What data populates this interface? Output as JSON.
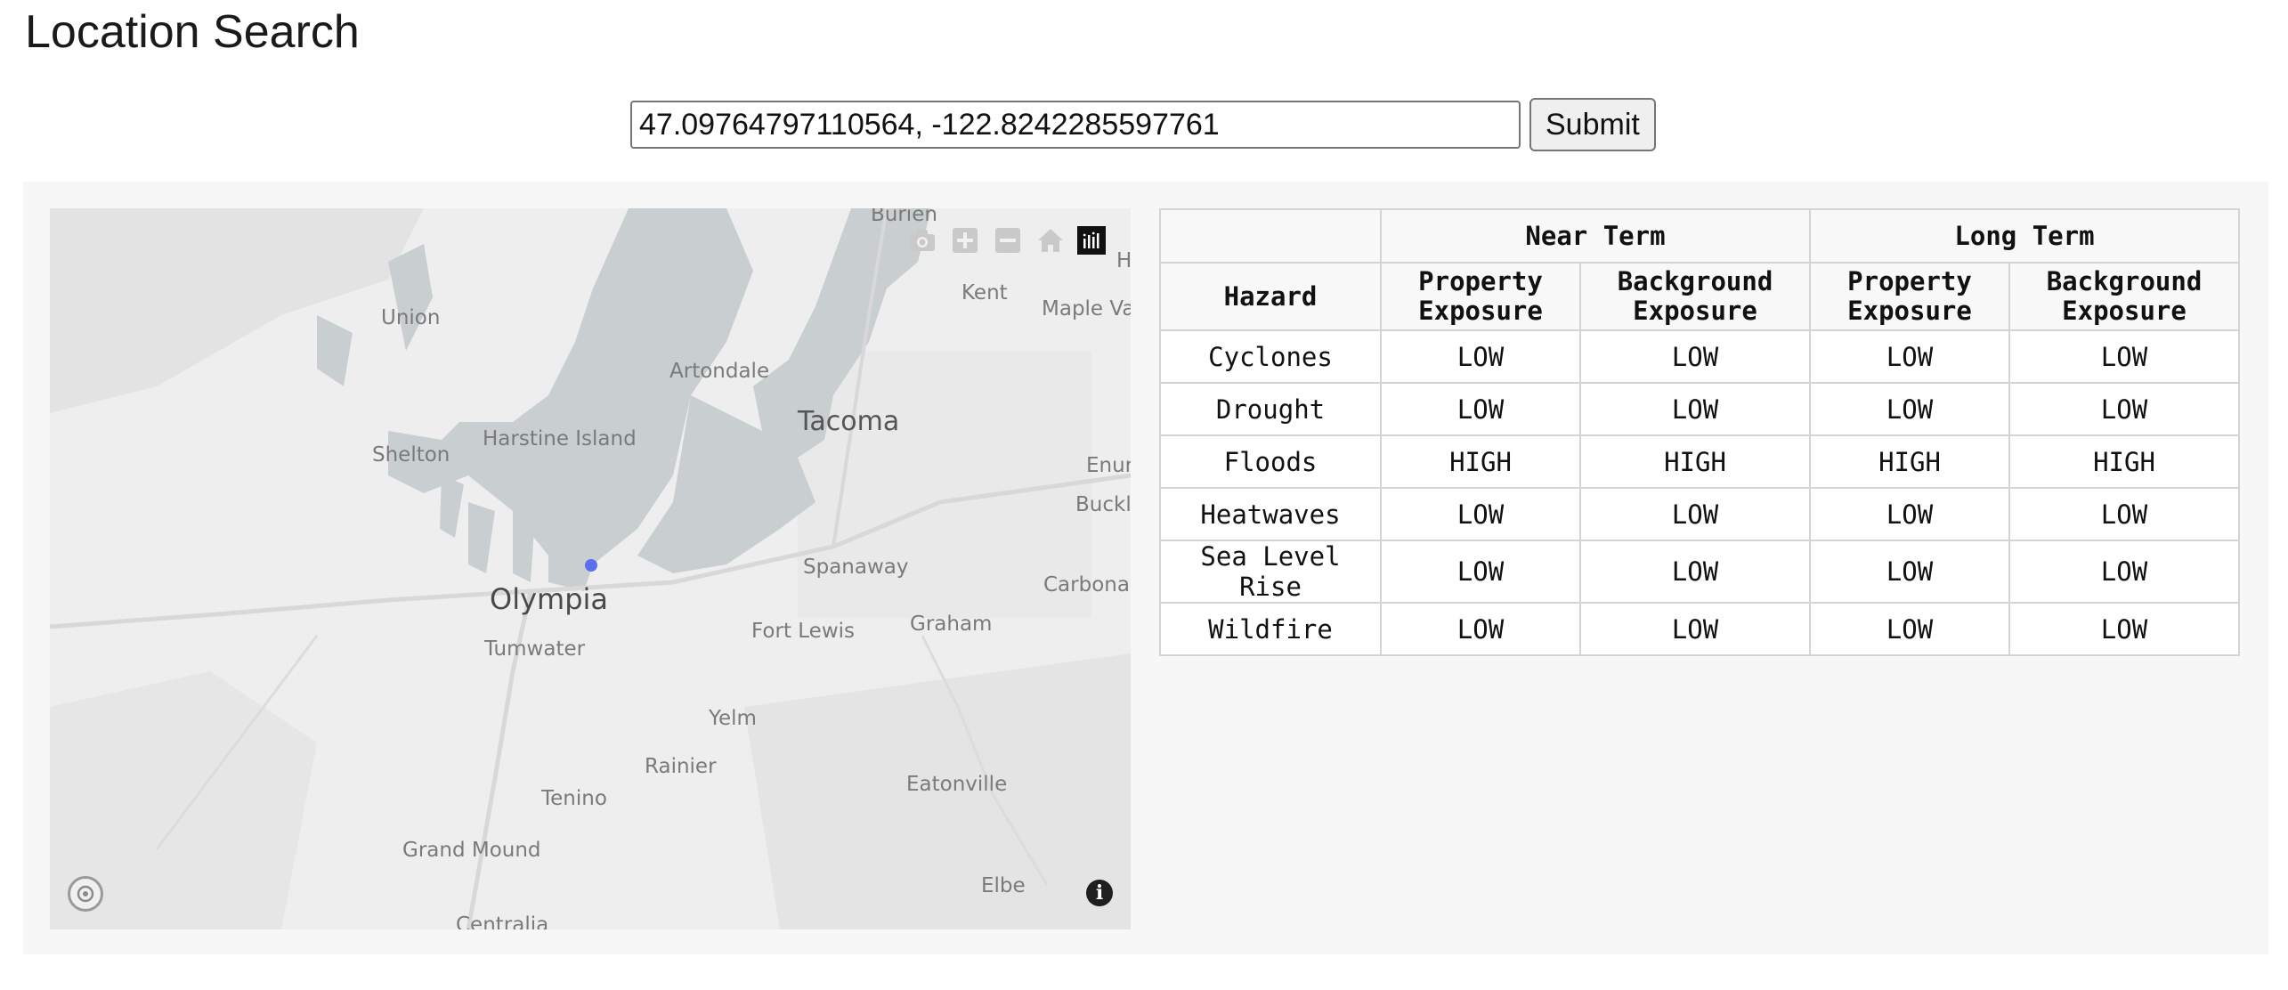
{
  "page": {
    "title": "Location Search"
  },
  "search": {
    "value": "47.09764797110564, -122.8242285597761",
    "submit_label": "Submit"
  },
  "map": {
    "labels": {
      "burien": "Burien",
      "union": "Union",
      "kent": "Kent",
      "maple_valley": "Maple Va",
      "artondale": "Artondale",
      "shelton": "Shelton",
      "harstine_island": "Harstine Island",
      "tacoma": "Tacoma",
      "enumclaw": "Enur",
      "buckley": "Buckl",
      "spanaway": "Spanaway",
      "olympia": "Olympia",
      "carbonado": "Carbonac",
      "tumwater": "Tumwater",
      "fort_lewis": "Fort Lewis",
      "graham": "Graham",
      "yelm": "Yelm",
      "rainier": "Rainier",
      "tenino": "Tenino",
      "eatonville": "Eatonville",
      "grand_mound": "Grand Mound",
      "elbe": "Elbe",
      "centralia": "Centralia",
      "edge_h": "H"
    },
    "marker_color": "#5a6ff0",
    "modebar_icons": [
      "camera-icon",
      "zoom-in-icon",
      "zoom-out-icon",
      "home-icon",
      "plotly-logo-icon"
    ]
  },
  "table": {
    "group_headers": {
      "near": "Near Term",
      "long": "Long Term"
    },
    "column_headers": {
      "hazard": "Hazard",
      "property_exposure": "Property Exposure",
      "background_exposure": "Background Exposure"
    },
    "rows": [
      {
        "hazard": "Cyclones",
        "near_property": "LOW",
        "near_background": "LOW",
        "long_property": "LOW",
        "long_background": "LOW"
      },
      {
        "hazard": "Drought",
        "near_property": "LOW",
        "near_background": "LOW",
        "long_property": "LOW",
        "long_background": "LOW"
      },
      {
        "hazard": "Floods",
        "near_property": "HIGH",
        "near_background": "HIGH",
        "long_property": "HIGH",
        "long_background": "HIGH"
      },
      {
        "hazard": "Heatwaves",
        "near_property": "LOW",
        "near_background": "LOW",
        "long_property": "LOW",
        "long_background": "LOW"
      },
      {
        "hazard": "Sea Level Rise",
        "near_property": "LOW",
        "near_background": "LOW",
        "long_property": "LOW",
        "long_background": "LOW"
      },
      {
        "hazard": "Wildfire",
        "near_property": "LOW",
        "near_background": "LOW",
        "long_property": "LOW",
        "long_background": "LOW"
      }
    ]
  }
}
